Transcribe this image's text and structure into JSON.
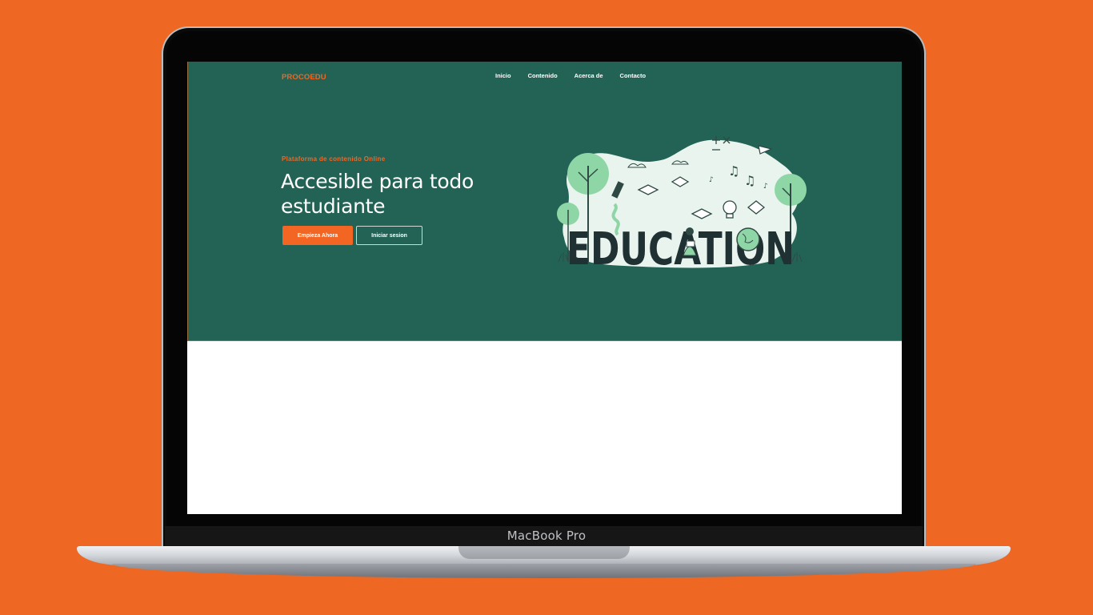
{
  "device": {
    "label": "MacBook Pro"
  },
  "site": {
    "brand": "PROCOEDU",
    "nav": [
      "Inicio",
      "Contenido",
      "Acerca de",
      "Contacto"
    ],
    "hero": {
      "eyebrow": "Plataforma de contenido Online",
      "headline_line1": "Accesible para todo",
      "headline_line2": "estudiante",
      "primary_button": "Empieza Ahora",
      "secondary_button": "Iniciar sesion",
      "illustration_text": "EDUCATION"
    }
  },
  "colors": {
    "background": "#ee6824",
    "hero": "#236356",
    "accent": "#f26522",
    "illustration_blob": "#eaf4ee",
    "illustration_green": "#8fd6a6",
    "illustration_text": "#1f3133"
  }
}
